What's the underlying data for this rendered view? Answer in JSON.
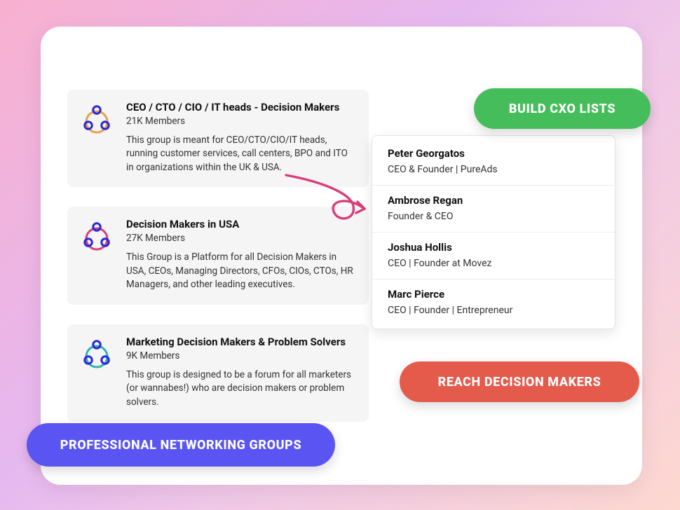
{
  "pills": {
    "build": "BUILD CXO LISTS",
    "reach": "REACH DECISION MAKERS",
    "groups": "PROFESSIONAL NETWORKING GROUPS"
  },
  "groups": [
    {
      "title": "CEO / CTO / CIO / IT heads - Decision Makers",
      "members": "21K Members",
      "desc": "This group is meant for CEO/CTO/CIO/IT heads, running customer services, call centers, BPO and ITO in organizations within the UK & USA.",
      "ring": "#e6a04a"
    },
    {
      "title": "Decision Makers in USA",
      "members": "27K Members",
      "desc": "This Group is a Platform for all Decision Makers in USA, CEOs, Managing Directors, CFOs, CIOs, CTOs, HR Managers, and other leading executives.",
      "ring": "#d93d7a"
    },
    {
      "title": "Marketing Decision Makers & Problem Solvers",
      "members": "9K Members",
      "desc": "This group is designed to be a forum for all marketers (or wannabes!) who are decision makers or problem solvers.",
      "ring": "#2fb2b0"
    }
  ],
  "people": [
    {
      "name": "Peter Georgatos",
      "role": "CEO & Founder | PureAds"
    },
    {
      "name": "Ambrose Regan",
      "role": "Founder & CEO"
    },
    {
      "name": "Joshua Hollis",
      "role": "CEO | Founder at Movez"
    },
    {
      "name": "Marc Pierce",
      "role": "CEO | Founder | Entrepreneur"
    }
  ]
}
